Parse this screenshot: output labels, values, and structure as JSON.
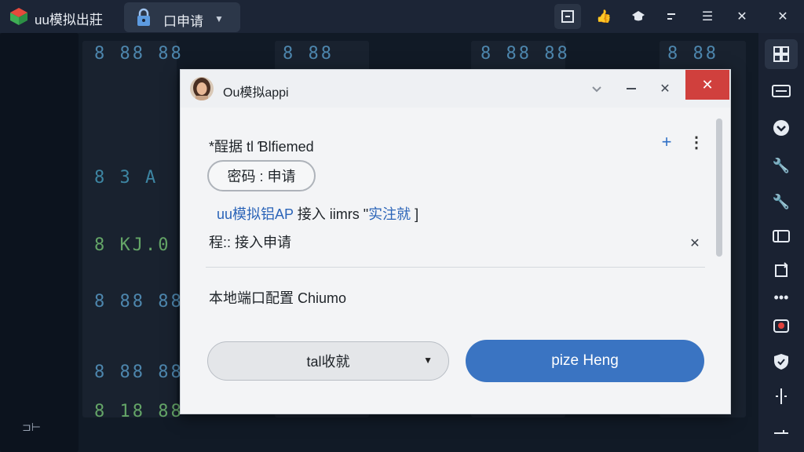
{
  "window": {
    "app_title": "uu模拟出莊",
    "tab_label": "口申请",
    "toolbar_icons": [
      "screen-fit-icon",
      "thumbs-up-icon",
      "hat-icon",
      "minimize-small-icon",
      "menu-icon",
      "close-icon",
      "window-close-icon"
    ]
  },
  "sidebar": {
    "icons": [
      "multi-screen-icon",
      "keyboard-icon",
      "chevron-down-circle-icon",
      "wrench-icon",
      "wrench-alt-icon",
      "resize-icon",
      "rotate-icon",
      "more-dots-icon",
      "record-icon",
      "shield-icon",
      "divider-icon",
      "minus-line-icon"
    ]
  },
  "background": {
    "corner_text": "⊐⊢"
  },
  "dialog": {
    "title": "Ou模拟appi",
    "section_title": "*酲据 tƖ Ɓlfiemed",
    "pill_label": "密码 : 申请",
    "link_row": {
      "prefix": "uu模拟铝AP",
      "middle": " 接入 iimrs  \"",
      "link": "实注就",
      "suffix": "  ]"
    },
    "process_label": "程:: 接入申请",
    "config_label": "本地端口配置 Chiumo",
    "select_label": "tal收就",
    "primary_label": "pize Heng"
  },
  "colors": {
    "titlebar": "#1c2536",
    "sidebar": "#1a2232",
    "dialog_bg": "#f3f4f6",
    "close_red": "#d0403d",
    "primary_blue": "#3a74c2",
    "link_blue": "#2b64b8"
  }
}
